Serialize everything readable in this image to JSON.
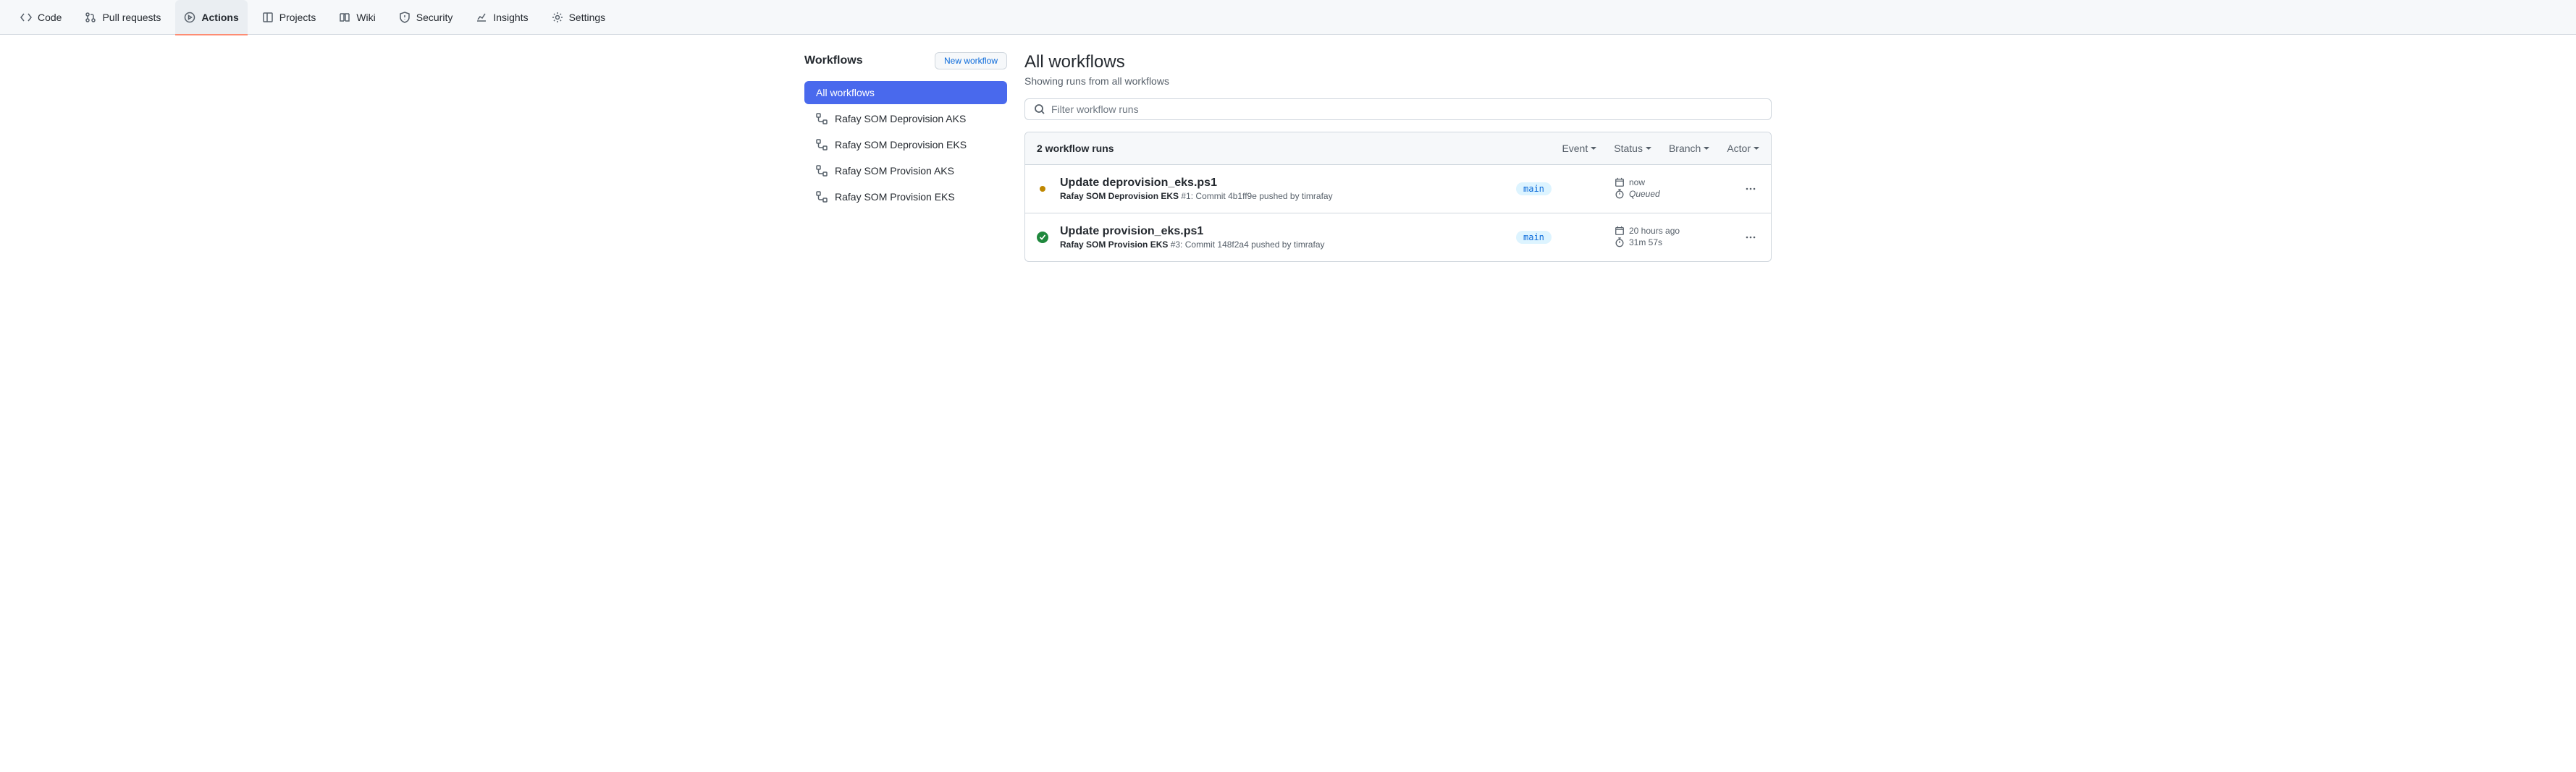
{
  "nav": {
    "items": [
      {
        "label": "Code"
      },
      {
        "label": "Pull requests"
      },
      {
        "label": "Actions"
      },
      {
        "label": "Projects"
      },
      {
        "label": "Wiki"
      },
      {
        "label": "Security"
      },
      {
        "label": "Insights"
      },
      {
        "label": "Settings"
      }
    ]
  },
  "sidebar": {
    "title": "Workflows",
    "new_btn": "New workflow",
    "all_label": "All workflows",
    "items": [
      {
        "label": "Rafay SOM Deprovision AKS"
      },
      {
        "label": "Rafay SOM Deprovision EKS"
      },
      {
        "label": "Rafay SOM Provision AKS"
      },
      {
        "label": "Rafay SOM Provision EKS"
      }
    ]
  },
  "main": {
    "title": "All workflows",
    "subtitle": "Showing runs from all workflows",
    "filter_placeholder": "Filter workflow runs",
    "runs_count": "2 workflow runs",
    "dd_event": "Event",
    "dd_status": "Status",
    "dd_branch": "Branch",
    "dd_actor": "Actor",
    "runs": [
      {
        "status": "queued",
        "title": "Update deprovision_eks.ps1",
        "workflow": "Rafay SOM Deprovision EKS",
        "suffix": " #1: Commit 4b1ff9e pushed by timrafay",
        "branch": "main",
        "time": "now",
        "duration": "Queued",
        "duration_italic": true
      },
      {
        "status": "success",
        "title": "Update provision_eks.ps1",
        "workflow": "Rafay SOM Provision EKS",
        "suffix": " #3: Commit 148f2a4 pushed by timrafay",
        "branch": "main",
        "time": "20 hours ago",
        "duration": "31m 57s",
        "duration_italic": false
      }
    ]
  }
}
